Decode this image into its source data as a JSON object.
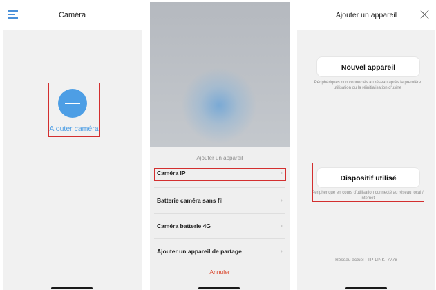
{
  "panel1": {
    "title": "Caméra",
    "add_label": "Ajouter caméra",
    "icons": [
      "menu-icon",
      "plus-icon"
    ],
    "accent": "#4d9ee5"
  },
  "panel2": {
    "sheet_title": "Ajouter un appareil",
    "items": [
      {
        "label": "Caméra IP"
      },
      {
        "label": "Batterie caméra sans fil"
      },
      {
        "label": "Caméra batterie 4G"
      },
      {
        "label": "Ajouter un appareil de partage"
      }
    ],
    "cancel": "Annuler",
    "cancel_color": "#d9452b"
  },
  "panel3": {
    "title": "Ajouter un appareil",
    "new_device": {
      "label": "Nouvel appareil",
      "description": "Périphériques non connectés au réseau après la première utilisation ou la réinitialisation d'usine"
    },
    "used_device": {
      "label": "Dispositif utilisé",
      "description": "Périphérique en cours d'utilisation connecté au réseau local / Internet"
    },
    "network": "Réseau actuel : TP-LINK_7778"
  },
  "highlight_color": "#d32f2f"
}
